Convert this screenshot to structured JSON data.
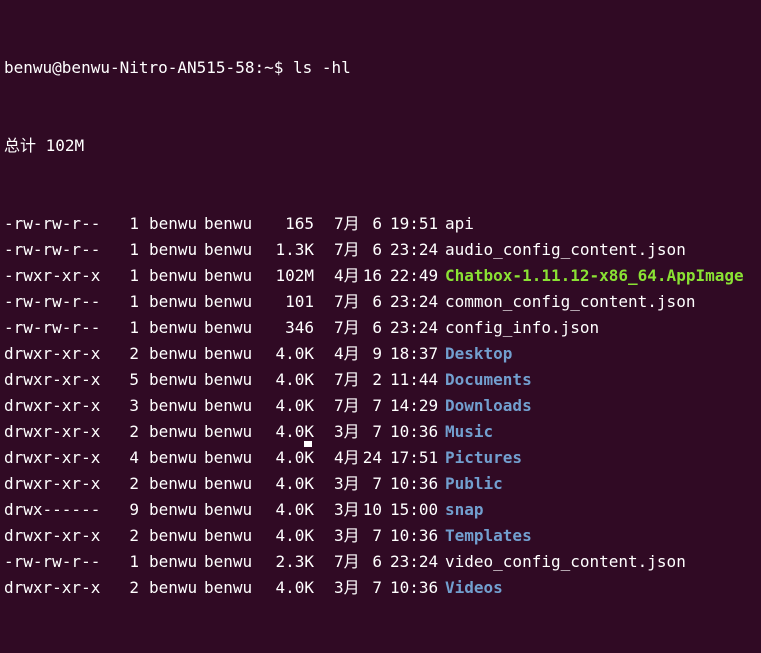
{
  "terminal": {
    "prompt": "benwu@benwu-Nitro-AN515-58:~$",
    "command": "ls -hl",
    "total": "总计 102M",
    "entries": [
      {
        "perms": "-rw-rw-r--",
        "links": "1",
        "owner": "benwu",
        "group": "benwu",
        "size": "165",
        "month": "7月",
        "day": "6",
        "time": "19:51",
        "name": "api",
        "type": "file"
      },
      {
        "perms": "-rw-rw-r--",
        "links": "1",
        "owner": "benwu",
        "group": "benwu",
        "size": "1.3K",
        "month": "7月",
        "day": "6",
        "time": "23:24",
        "name": "audio_config_content.json",
        "type": "file"
      },
      {
        "perms": "-rwxr-xr-x",
        "links": "1",
        "owner": "benwu",
        "group": "benwu",
        "size": "102M",
        "month": "4月",
        "day": "16",
        "time": "22:49",
        "name": "Chatbox-1.11.12-x86_64.AppImage",
        "type": "exec"
      },
      {
        "perms": "-rw-rw-r--",
        "links": "1",
        "owner": "benwu",
        "group": "benwu",
        "size": "101",
        "month": "7月",
        "day": "6",
        "time": "23:24",
        "name": "common_config_content.json",
        "type": "file"
      },
      {
        "perms": "-rw-rw-r--",
        "links": "1",
        "owner": "benwu",
        "group": "benwu",
        "size": "346",
        "month": "7月",
        "day": "6",
        "time": "23:24",
        "name": "config_info.json",
        "type": "file"
      },
      {
        "perms": "drwxr-xr-x",
        "links": "2",
        "owner": "benwu",
        "group": "benwu",
        "size": "4.0K",
        "month": "4月",
        "day": "9",
        "time": "18:37",
        "name": "Desktop",
        "type": "dir"
      },
      {
        "perms": "drwxr-xr-x",
        "links": "5",
        "owner": "benwu",
        "group": "benwu",
        "size": "4.0K",
        "month": "7月",
        "day": "2",
        "time": "11:44",
        "name": "Documents",
        "type": "dir"
      },
      {
        "perms": "drwxr-xr-x",
        "links": "3",
        "owner": "benwu",
        "group": "benwu",
        "size": "4.0K",
        "month": "7月",
        "day": "7",
        "time": "14:29",
        "name": "Downloads",
        "type": "dir"
      },
      {
        "perms": "drwxr-xr-x",
        "links": "2",
        "owner": "benwu",
        "group": "benwu",
        "size": "4.0K",
        "month": "3月",
        "day": "7",
        "time": "10:36",
        "name": "Music",
        "type": "dir"
      },
      {
        "perms": "drwxr-xr-x",
        "links": "4",
        "owner": "benwu",
        "group": "benwu",
        "size": "4.0K",
        "month": "4月",
        "day": "24",
        "time": "17:51",
        "name": "Pictures",
        "type": "dir"
      },
      {
        "perms": "drwxr-xr-x",
        "links": "2",
        "owner": "benwu",
        "group": "benwu",
        "size": "4.0K",
        "month": "3月",
        "day": "7",
        "time": "10:36",
        "name": "Public",
        "type": "dir"
      },
      {
        "perms": "drwx------",
        "links": "9",
        "owner": "benwu",
        "group": "benwu",
        "size": "4.0K",
        "month": "3月",
        "day": "10",
        "time": "15:00",
        "name": "snap",
        "type": "dir"
      },
      {
        "perms": "drwxr-xr-x",
        "links": "2",
        "owner": "benwu",
        "group": "benwu",
        "size": "4.0K",
        "month": "3月",
        "day": "7",
        "time": "10:36",
        "name": "Templates",
        "type": "dir"
      },
      {
        "perms": "-rw-rw-r--",
        "links": "1",
        "owner": "benwu",
        "group": "benwu",
        "size": "2.3K",
        "month": "7月",
        "day": "6",
        "time": "23:24",
        "name": "video_config_content.json",
        "type": "file"
      },
      {
        "perms": "drwxr-xr-x",
        "links": "2",
        "owner": "benwu",
        "group": "benwu",
        "size": "4.0K",
        "month": "3月",
        "day": "7",
        "time": "10:36",
        "name": "Videos",
        "type": "dir"
      }
    ]
  },
  "colors": {
    "background": "#300a24",
    "text": "#ffffff",
    "directory": "#729fcf",
    "executable": "#8ae234"
  }
}
